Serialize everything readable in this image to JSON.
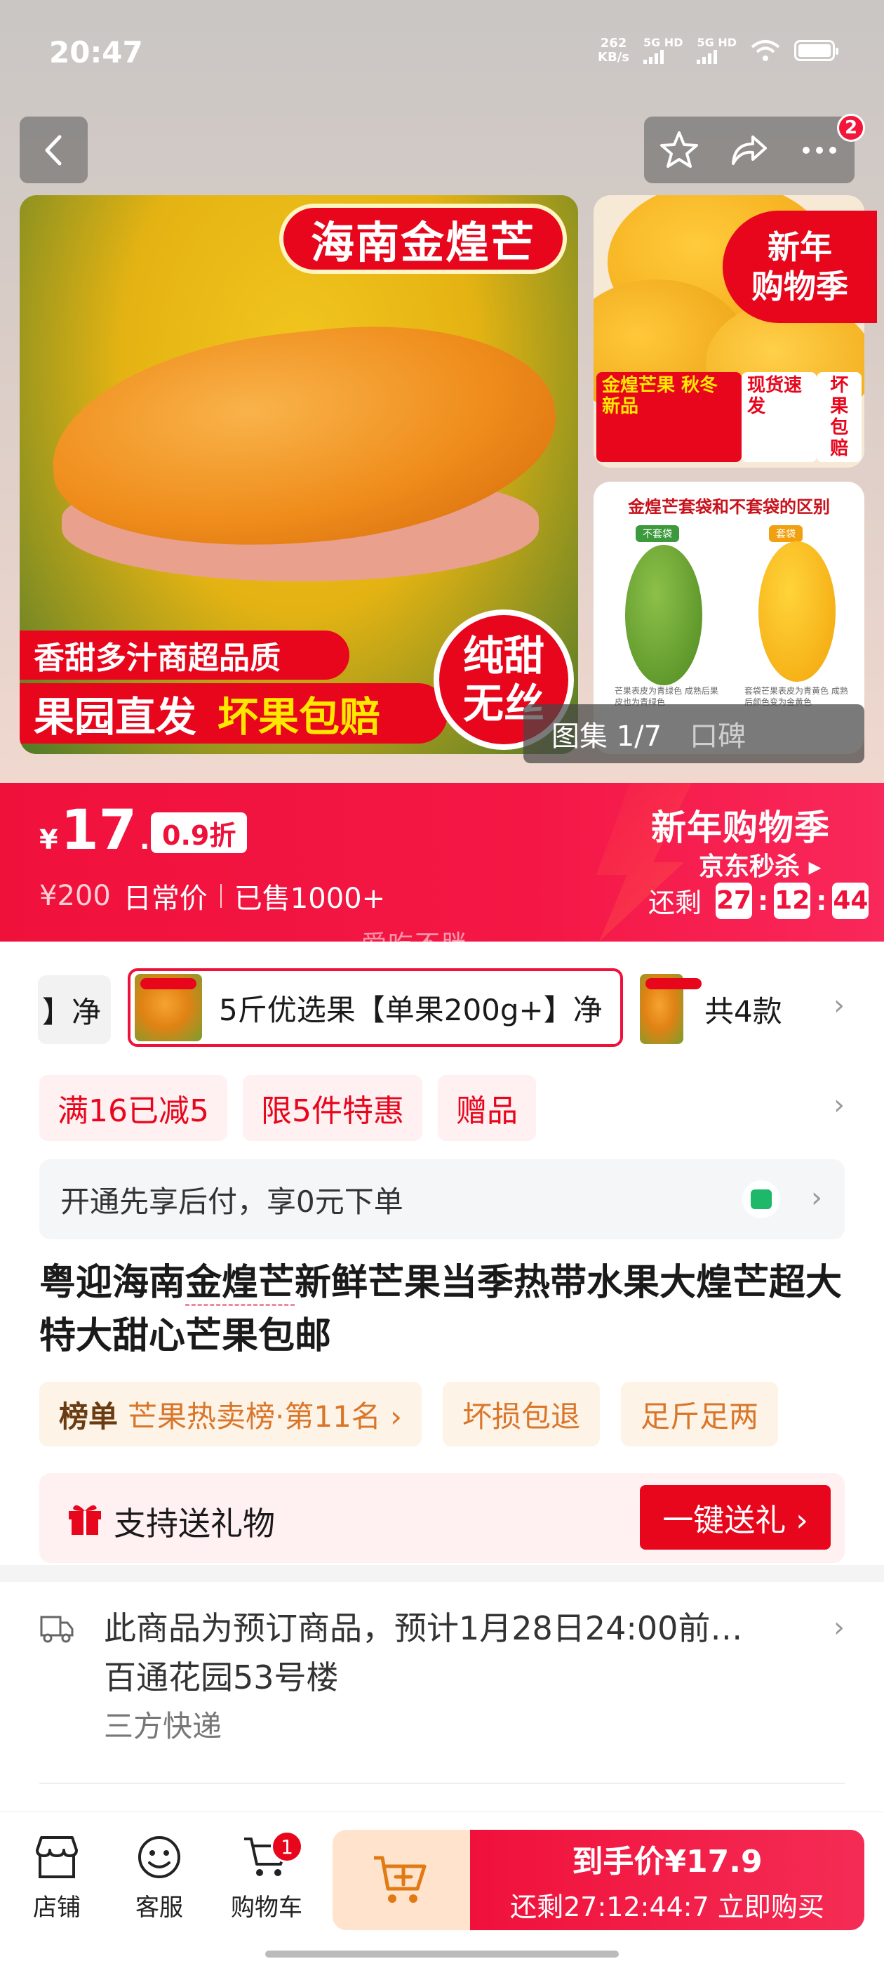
{
  "status_bar": {
    "time": "20:47",
    "net_speed_value": "262",
    "net_speed_unit": "KB/s",
    "sim1": "5G HD",
    "sim2": "5G HD"
  },
  "top_nav": {
    "notification_count": "2"
  },
  "gallery": {
    "main_title": "海南金煌芒",
    "promo_line1_a": "香甜多汁",
    "promo_line1_b": "商超品质",
    "promo_line2_a": "果园直发",
    "promo_line2_b": "坏果包赔",
    "seal_text": "纯甜\n无丝",
    "side1_badge": "新年\n购物季",
    "side1_tags": [
      "金煌芒果 秋冬新品",
      "现货速发",
      "坏果包赔"
    ],
    "side2_title": "金煌芒套袋和不套袋的区别",
    "side2_label_left": "不套袋",
    "side2_label_right": "套袋",
    "side2_caption_left": "芒果表皮为青绿色 成熟后果皮也为青绿色",
    "side2_caption_right": "套袋芒果表皮为青黄色 成熟后颜色变为金黄色",
    "counter": "图集 1/7",
    "counter_secondary": "口碑"
  },
  "price_banner": {
    "currency": "¥",
    "price_int": "17",
    "price_dec": ".9",
    "discount": "0.9折",
    "orig_price": "¥200",
    "orig_label": "日常价",
    "sold": "已售1000+",
    "event_title": "新年购物季",
    "event_sub": "京东秒杀 ▸",
    "countdown_label": "还剩",
    "countdown": {
      "h": "27",
      "m": "12",
      "s": "44"
    },
    "watermark": "爱吃不胖"
  },
  "variants": {
    "partial_label": "】净",
    "selected_label": "5斤优选果【单果200g+】净",
    "count_label": "共4款"
  },
  "promos": [
    "满16已减5",
    "限5件特惠",
    "赠品"
  ],
  "paylater": {
    "text": "开通先享后付，享0元下单"
  },
  "product": {
    "title_pre": "粤迎海南",
    "title_link": "金煌芒",
    "title_post": "新鲜芒果当季热带水果大煌芒超大特大甜心芒果包邮"
  },
  "badges": {
    "rank_head": "榜单",
    "rank_text": "芒果热卖榜·第11名 ›",
    "items": [
      "坏损包退",
      "足斤足两"
    ]
  },
  "gift": {
    "label": "支持送礼物",
    "button": "一键送礼 ›"
  },
  "shipping": {
    "line1": "此商品为预订商品，预计1月28日24:00前…",
    "line2": "百通花园53号楼",
    "line3": "三方快递"
  },
  "bottom_bar": {
    "store": "店铺",
    "service": "客服",
    "cart": "购物车",
    "cart_count": "1",
    "buy_line1": "到手价¥17.9",
    "buy_line2": "还剩27:12:44:7  立即购买"
  },
  "colors": {
    "brand_red": "#f0113b",
    "promo_bg": "#fff0f2",
    "badge_bg": "#fdf3e6"
  }
}
